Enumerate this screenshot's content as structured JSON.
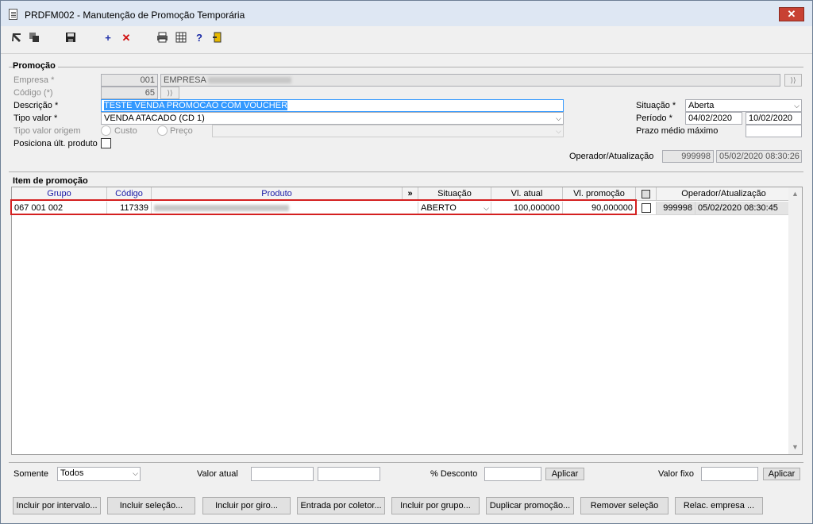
{
  "window": {
    "title": "PRDFM002 - Manutenção de Promoção Temporária"
  },
  "toolbar": {
    "icons": [
      "cursor-back-icon",
      "copy-icon",
      "save-icon",
      "add-icon",
      "delete-icon",
      "print-icon",
      "table-icon",
      "help-icon",
      "exit-icon"
    ]
  },
  "promocao": {
    "section_label": "Promoção",
    "empresa_label": "Empresa *",
    "empresa_code": "001",
    "empresa_name": "EMPRESA",
    "codigo_label": "Código (*)",
    "codigo_value": "65",
    "descricao_label": "Descrição *",
    "descricao_value": "TESTE VENDA PROMOCAO COM VOUCHER",
    "tipo_valor_label": "Tipo valor *",
    "tipo_valor_value": "VENDA ATACADO (CD 1)",
    "tipo_valor_origem_label": "Tipo valor origem",
    "radio_custo": "Custo",
    "radio_preco": "Preço",
    "posiciona_label": "Posiciona últ. produto",
    "situacao_label": "Situação *",
    "situacao_value": "Aberta",
    "periodo_label": "Período *",
    "periodo_inicio": "04/02/2020",
    "periodo_fim": "10/02/2020",
    "prazo_label": "Prazo médio máximo",
    "operador_label": "Operador/Atualização",
    "operador_value": "999998",
    "atualizacao_value": "05/02/2020 08:30:26"
  },
  "itens": {
    "section_label": "Item de promoção",
    "columns": {
      "grupo": "Grupo",
      "codigo": "Código",
      "produto": "Produto",
      "expand": "»",
      "situacao": "Situação",
      "vl_atual": "Vl. atual",
      "vl_promocao": "Vl. promoção",
      "operador": "Operador/Atualização"
    },
    "rows": [
      {
        "grupo": "067 001 002",
        "codigo": "117339",
        "situacao": "ABERTO",
        "vl_atual": "100,000000",
        "vl_promocao": "90,000000",
        "operador": "999998",
        "atualizacao": "05/02/2020 08:30:45"
      }
    ]
  },
  "filters": {
    "somente_label": "Somente",
    "somente_value": "Todos",
    "valor_atual_label": "Valor atual",
    "desconto_label": "% Desconto",
    "aplicar_label": "Aplicar",
    "valor_fixo_label": "Valor fixo",
    "aplicar2_label": "Aplicar"
  },
  "actions": {
    "incluir_intervalo": "Incluir por intervalo...",
    "incluir_selecao": "Incluir seleção...",
    "incluir_giro": "Incluir por giro...",
    "entrada_coletor": "Entrada por coletor...",
    "incluir_grupo": "Incluir por grupo...",
    "duplicar": "Duplicar promoção...",
    "remover": "Remover seleção",
    "relac_empresa": "Relac. empresa ..."
  },
  "colors": {
    "highlight": "#3399ff",
    "selection_outline": "#d42020",
    "close_button": "#c84133",
    "header_blue": "#1a1aa6"
  }
}
